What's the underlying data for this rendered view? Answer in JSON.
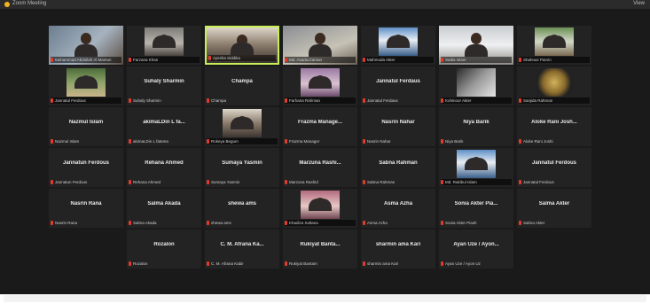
{
  "window": {
    "title": "Zoom Meeting",
    "view_label": "View"
  },
  "participants": [
    {
      "display": "",
      "label": "Muhammad Abdullah Al Mamun",
      "video": "bg-office",
      "avatar": true,
      "size": "full"
    },
    {
      "display": "",
      "label": "Farzana Khan",
      "video": "bg-grey-room",
      "avatar": true,
      "size": "med"
    },
    {
      "display": "",
      "label": "Ayesha Siddika",
      "video": "bg-hijab",
      "avatar": true,
      "size": "full",
      "active": true
    },
    {
      "display": "",
      "label": "Md. Asaduzzaman",
      "video": "bg-room",
      "avatar": true,
      "size": "full"
    },
    {
      "display": "",
      "label": "Mahmuda Akter",
      "video": "bg-blue",
      "avatar": true,
      "size": "med"
    },
    {
      "display": "",
      "label": "Sadia Islam",
      "video": "bg-white-room",
      "avatar": true,
      "size": "full"
    },
    {
      "display": "",
      "label": "Shahnaz Parvin",
      "video": "bg-green-room",
      "avatar": true,
      "size": "med"
    },
    {
      "display": "",
      "label": "Jannatul Ferdous",
      "video": "bg-plant",
      "avatar": true,
      "size": "med"
    },
    {
      "display": "Suhaly Sharmin",
      "label": "Suhaly Sharmin"
    },
    {
      "display": "Champa",
      "label": "Champa"
    },
    {
      "display": "",
      "label": "Farhana Rahman",
      "video": "bg-purple",
      "avatar": true,
      "size": "med"
    },
    {
      "display": "Jannatul Ferdaus",
      "label": "Jannatul Ferdaus"
    },
    {
      "display": "",
      "label": "Kohinoor Akter",
      "video": "bg-bw",
      "avatar": false,
      "size": "med"
    },
    {
      "display": "",
      "label": "Sanjida Rahman",
      "video": "bg-seal",
      "avatar": false,
      "size": "med"
    },
    {
      "display": "Nazmul Islam",
      "label": "Nazmul Islam"
    },
    {
      "display": "akimaLDin L fa...",
      "label": "akimaLDin L fatema"
    },
    {
      "display": "",
      "label": "Rokeya Begum",
      "video": "bg-hijab",
      "avatar": true,
      "size": "med"
    },
    {
      "display": "Frazma Manage...",
      "label": "Frazma Manager"
    },
    {
      "display": "Nasrin Nahar",
      "label": "Nasrin Nahar"
    },
    {
      "display": "Niya Barik",
      "label": "Niya Barik"
    },
    {
      "display": "Aloke Rani Josh...",
      "label": "Aloke Rani Joshi"
    },
    {
      "display": "Jannatun Ferdous",
      "label": "Jannatun Ferdous"
    },
    {
      "display": "Rehana Ahmed",
      "label": "Rehana Ahmed"
    },
    {
      "display": "Sumaya Yasmin",
      "label": "Sumaya Yasmin"
    },
    {
      "display": "Marzuna Rashi...",
      "label": "Marzuna Rashid"
    },
    {
      "display": "Sabna Rahman",
      "label": "Sabna Rahman"
    },
    {
      "display": "",
      "label": "Md. Rakibul Islam",
      "video": "bg-blue",
      "avatar": true,
      "size": "med"
    },
    {
      "display": "Jannatul Ferdous",
      "label": "Jannatul Ferdous"
    },
    {
      "display": "Nasrin Rana",
      "label": "Nasrin Rana"
    },
    {
      "display": "Salma Akada",
      "label": "Salma Akada"
    },
    {
      "display": "shewa ams",
      "label": "shewa ams"
    },
    {
      "display": "",
      "label": "Khadiza Sultana",
      "video": "bg-pink",
      "avatar": true,
      "size": "med"
    },
    {
      "display": "Asma Azha",
      "label": "Asma Azha"
    },
    {
      "display": "Sonia Akter Pia...",
      "label": "Sonia Akter Piash"
    },
    {
      "display": "Salma Akter",
      "label": "Salma Akter"
    },
    {
      "display": "Rozalon",
      "label": "Rozalon"
    },
    {
      "display": "C. M. Afrana Ka...",
      "label": "C. M. Afrana Kabir"
    },
    {
      "display": "Rukiyat Banta...",
      "label": "Rukiyat Bantam"
    },
    {
      "display": "sharmin ama Kari",
      "label": "sharmin ama Kari"
    },
    {
      "display": "Ayan Uze / Ayon...",
      "label": "Ayan Uze / Ayon Uz"
    }
  ],
  "colors": {
    "background": "#1a1a1a",
    "tile": "#232323",
    "active_border": "#c8ef5a",
    "muted_mic": "#e23b2e"
  }
}
